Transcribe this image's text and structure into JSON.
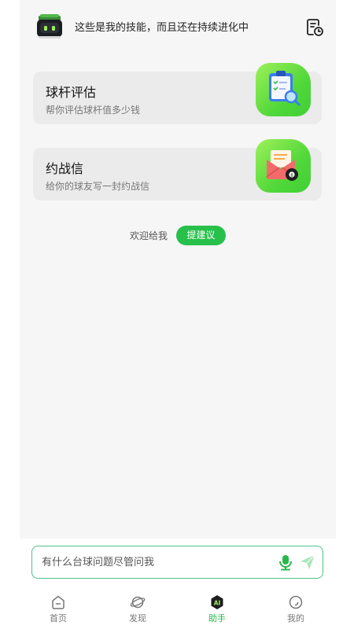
{
  "header": {
    "intro_text": "这些是我的技能，而且还在持续进化中",
    "avatar_icon": "robot-avatar-icon",
    "history_icon": "history-list-icon"
  },
  "skills": [
    {
      "title": "球杆评估",
      "subtitle": "帮你评估球杆值多少钱",
      "icon": "clipboard-magnifier-icon"
    },
    {
      "title": "约战信",
      "subtitle": "给你的球友写一封约战信",
      "icon": "envelope-billiard-ball-icon"
    }
  ],
  "feedback": {
    "label": "欢迎给我",
    "button_label": "提建议"
  },
  "chat": {
    "placeholder": "有什么台球问题尽管问我",
    "mic_icon": "microphone-icon",
    "send_icon": "send-icon"
  },
  "tabs": [
    {
      "label": "首页",
      "icon": "home-icon",
      "active": false
    },
    {
      "label": "发现",
      "icon": "planet-icon",
      "active": false
    },
    {
      "label": "助手",
      "icon": "ai-icon",
      "active": true
    },
    {
      "label": "我的",
      "icon": "profile-icon",
      "active": false
    }
  ],
  "colors": {
    "accent": "#27c04a",
    "card_background": "#ebebeb",
    "page_background": "#f6f6f6",
    "input_border": "#4cc38a"
  }
}
